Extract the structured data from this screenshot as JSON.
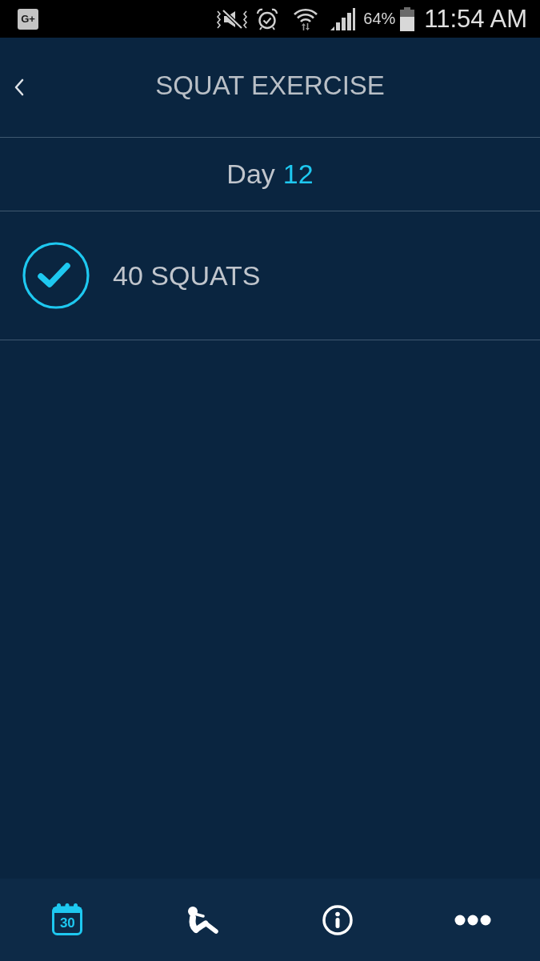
{
  "status_bar": {
    "notification": "G+",
    "battery": "64%",
    "time": "11:54 AM"
  },
  "header": {
    "title": "SQUAT EXERCISE"
  },
  "day": {
    "label": "Day",
    "number": "12"
  },
  "exercises": [
    {
      "label": "40 SQUATS",
      "checked": true
    }
  ],
  "nav": [
    {
      "kind": "calendar",
      "label": "30",
      "selected": true
    },
    {
      "kind": "workout",
      "selected": false
    },
    {
      "kind": "info",
      "selected": false
    },
    {
      "kind": "more",
      "selected": false
    }
  ]
}
